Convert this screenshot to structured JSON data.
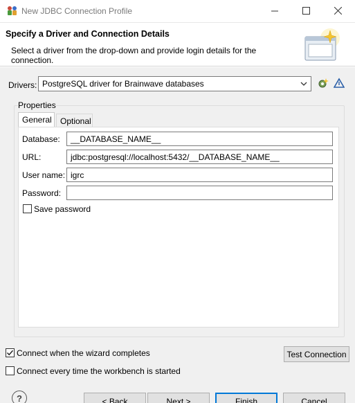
{
  "window": {
    "title": "New JDBC Connection Profile",
    "app_icon": "database-connection-icon"
  },
  "header": {
    "title": "Specify a Driver and Connection Details",
    "description": "Select a driver from the drop-down and provide login details for the connection.",
    "banner_icon": "wizard-banner-icon"
  },
  "drivers": {
    "label": "Drivers:",
    "selected": "PostgreSQL driver for Brainwave databases",
    "new_driver_icon": "new-driver-icon",
    "edit_driver_icon": "edit-driver-icon"
  },
  "properties": {
    "legend": "Properties",
    "tabs": [
      {
        "label": "General",
        "active": true
      },
      {
        "label": "Optional",
        "active": false
      }
    ],
    "fields": {
      "database": {
        "label": "Database:",
        "value": "__DATABASE_NAME__"
      },
      "url": {
        "label": "URL:",
        "value": "jdbc:postgresql://localhost:5432/__DATABASE_NAME__"
      },
      "username": {
        "label": "User name:",
        "value": "igrc"
      },
      "password": {
        "label": "Password:",
        "value": ""
      }
    },
    "save_password": {
      "label": "Save password",
      "checked": false
    }
  },
  "options": {
    "connect_on_finish": {
      "label": "Connect when the wizard completes",
      "checked": true
    },
    "connect_on_startup": {
      "label": "Connect every time the workbench is started",
      "checked": false
    },
    "test_connection_label": "Test Connection"
  },
  "buttons": {
    "help": "?",
    "back": "< Back",
    "next": "Next >",
    "finish": "Finish",
    "cancel": "Cancel"
  },
  "colors": {
    "accent": "#0078d7",
    "content_bg": "#f0f0f0",
    "button_bg": "#e1e1e1"
  }
}
